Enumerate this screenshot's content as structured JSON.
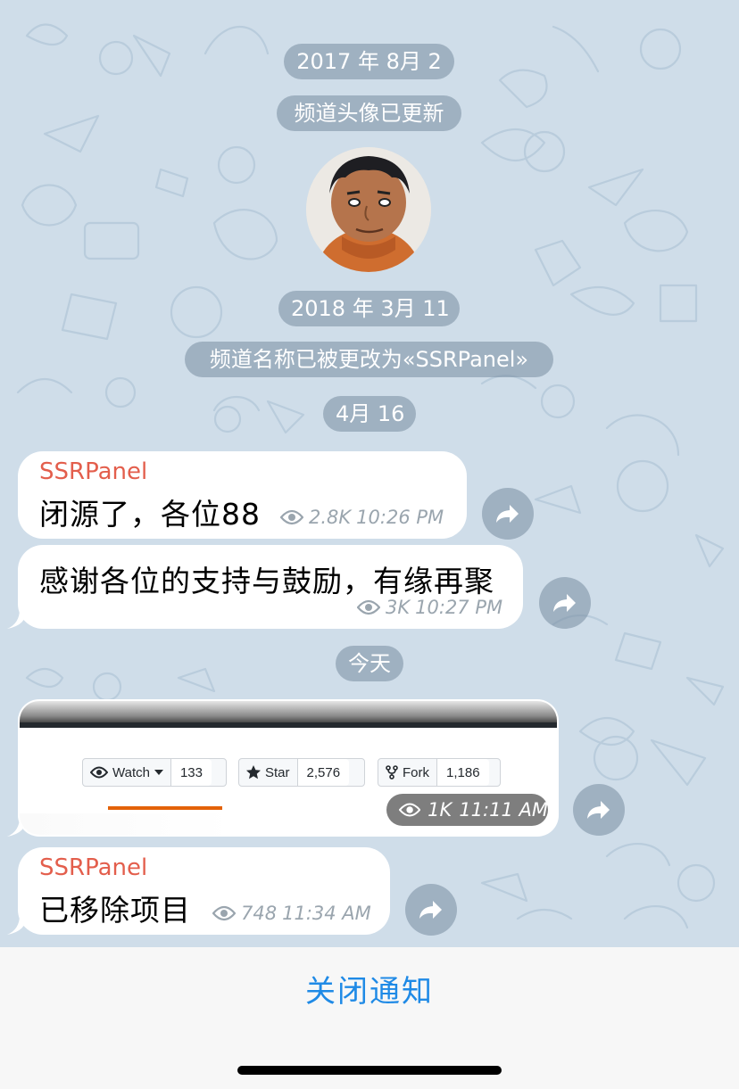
{
  "dates": {
    "d1": "2017 年 8月 2",
    "d2": "2018 年 3月 11",
    "d3": "4月 16",
    "d4": "今天"
  },
  "service": {
    "avatar_updated": "频道头像已更新",
    "name_changed": "频道名称已被更改为«SSRPanel»"
  },
  "messages": [
    {
      "sender": "SSRPanel",
      "text": "闭源了，各位88",
      "views": "2.8K",
      "time": "10:26 PM"
    },
    {
      "text": "感谢各位的支持与鼓励，有缘再聚",
      "views": "3K",
      "time": "10:27 PM"
    },
    {
      "photo": {
        "watch_label": "Watch",
        "watch_count": "133",
        "star_label": "Star",
        "star_count": "2,576",
        "fork_label": "Fork",
        "fork_count": "1,186"
      },
      "views": "1K",
      "time": "11:11 AM"
    },
    {
      "sender": "SSRPanel",
      "text": "已移除项目",
      "views": "748",
      "time": "11:34 AM"
    }
  ],
  "bottom": {
    "mute_label": "关闭通知"
  },
  "colors": {
    "sender": "#e35e4c",
    "accent": "#1f8ae6",
    "background": "#cfdde9"
  }
}
